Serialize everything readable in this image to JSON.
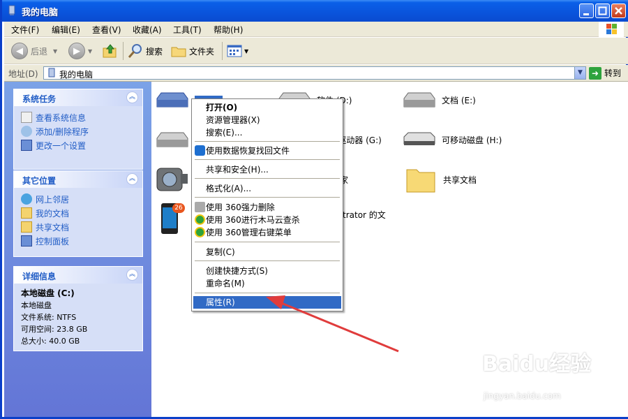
{
  "window": {
    "title": "我的电脑"
  },
  "menu": [
    "文件(F)",
    "编辑(E)",
    "查看(V)",
    "收藏(A)",
    "工具(T)",
    "帮助(H)"
  ],
  "toolbar": {
    "back": "后退",
    "search": "搜索",
    "folders": "文件夹"
  },
  "address": {
    "label": "地址(D)",
    "value": "我的电脑",
    "go": "转到"
  },
  "panels": {
    "system_tasks": {
      "title": "系统任务",
      "items": [
        "查看系统信息",
        "添加/删除程序",
        "更改一个设置"
      ]
    },
    "other_places": {
      "title": "其它位置",
      "items": [
        "网上邻居",
        "我的文档",
        "共享文档",
        "控制面板"
      ]
    },
    "details": {
      "title": "详细信息",
      "name": "本地磁盘 (C:)",
      "type": "本地磁盘",
      "fs": "文件系统: NTFS",
      "free": "可用空间: 23.8 GB",
      "total": "总大小: 40.0 GB"
    }
  },
  "items": {
    "d_drive": "软件 (D:)",
    "e_drive": "文档 (E:)",
    "g_drive": "DVD 驱动器 (G:)",
    "h_drive": "可移动磁盘 (H:)",
    "camera_partial": "管家",
    "shared": "共享文档",
    "admin_docs_partial": "trator 的文",
    "badge": "26"
  },
  "context_menu": {
    "open": "打开(O)",
    "explorer": "资源管理器(X)",
    "search": "搜索(E)...",
    "recover": "使用数据恢复找回文件",
    "sharing": "共享和安全(H)...",
    "format": "格式化(A)...",
    "del360": "使用 360强力删除",
    "trojan360": "使用 360进行木马云查杀",
    "manage360": "使用 360管理右键菜单",
    "copy": "复制(C)",
    "shortcut": "创建快捷方式(S)",
    "rename": "重命名(M)",
    "properties": "属性(R)"
  },
  "watermark": {
    "brand": "Baidu经验",
    "url": "jingyan.baidu.com"
  },
  "colors": {
    "title_blue": "#0a55dd",
    "link_blue": "#215dc6",
    "highlight": "#316ac5",
    "arrow_red": "#e03c3c"
  }
}
